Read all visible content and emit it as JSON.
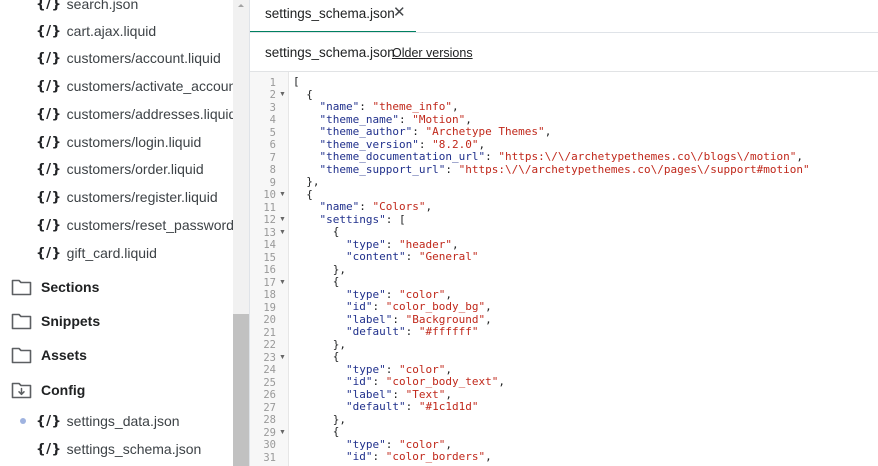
{
  "sidebar": {
    "files_top": [
      {
        "icon": "{/}",
        "label": "search.json"
      },
      {
        "icon": "{/}",
        "label": "cart.ajax.liquid"
      },
      {
        "icon": "{/}",
        "label": "customers/account.liquid"
      },
      {
        "icon": "{/}",
        "label": "customers/activate_account.li"
      },
      {
        "icon": "{/}",
        "label": "customers/addresses.liquid"
      },
      {
        "icon": "{/}",
        "label": "customers/login.liquid"
      },
      {
        "icon": "{/}",
        "label": "customers/order.liquid"
      },
      {
        "icon": "{/}",
        "label": "customers/register.liquid"
      },
      {
        "icon": "{/}",
        "label": "customers/reset_password.lic"
      },
      {
        "icon": "{/}",
        "label": "gift_card.liquid"
      }
    ],
    "folders": [
      {
        "label": "Sections",
        "icon": "folder-icon"
      },
      {
        "label": "Snippets",
        "icon": "folder-icon"
      },
      {
        "label": "Assets",
        "icon": "folder-icon"
      },
      {
        "label": "Config",
        "icon": "folder-open-icon"
      }
    ],
    "config_files": [
      {
        "icon": "{/}",
        "label": "settings_data.json"
      },
      {
        "icon": "{/}",
        "label": "settings_schema.json"
      }
    ]
  },
  "tab": {
    "label": "settings_schema.json",
    "close": "✕"
  },
  "file_header": {
    "title": "settings_schema.json",
    "older_versions": "Older versions"
  },
  "colors": {
    "accent": "#008060",
    "key": "#20308c",
    "string": "#c0281b",
    "gutter_bg": "#f7f7f7"
  },
  "editor": {
    "lines": [
      {
        "n": "1",
        "fold": false,
        "text": "["
      },
      {
        "n": "2",
        "fold": true,
        "text": "  {"
      },
      {
        "n": "3",
        "fold": false,
        "text": "    \"name\": \"theme_info\","
      },
      {
        "n": "4",
        "fold": false,
        "text": "    \"theme_name\": \"Motion\","
      },
      {
        "n": "5",
        "fold": false,
        "text": "    \"theme_author\": \"Archetype Themes\","
      },
      {
        "n": "6",
        "fold": false,
        "text": "    \"theme_version\": \"8.2.0\","
      },
      {
        "n": "7",
        "fold": false,
        "text": "    \"theme_documentation_url\": \"https:\\/\\/archetypethemes.co\\/blogs\\/motion\","
      },
      {
        "n": "8",
        "fold": false,
        "text": "    \"theme_support_url\": \"https:\\/\\/archetypethemes.co\\/pages\\/support#motion\""
      },
      {
        "n": "9",
        "fold": false,
        "text": "  },"
      },
      {
        "n": "10",
        "fold": true,
        "text": "  {"
      },
      {
        "n": "11",
        "fold": false,
        "text": "    \"name\": \"Colors\","
      },
      {
        "n": "12",
        "fold": true,
        "text": "    \"settings\": ["
      },
      {
        "n": "13",
        "fold": true,
        "text": "      {"
      },
      {
        "n": "14",
        "fold": false,
        "text": "        \"type\": \"header\","
      },
      {
        "n": "15",
        "fold": false,
        "text": "        \"content\": \"General\""
      },
      {
        "n": "16",
        "fold": false,
        "text": "      },"
      },
      {
        "n": "17",
        "fold": true,
        "text": "      {"
      },
      {
        "n": "18",
        "fold": false,
        "text": "        \"type\": \"color\","
      },
      {
        "n": "19",
        "fold": false,
        "text": "        \"id\": \"color_body_bg\","
      },
      {
        "n": "20",
        "fold": false,
        "text": "        \"label\": \"Background\","
      },
      {
        "n": "21",
        "fold": false,
        "text": "        \"default\": \"#ffffff\""
      },
      {
        "n": "22",
        "fold": false,
        "text": "      },"
      },
      {
        "n": "23",
        "fold": true,
        "text": "      {"
      },
      {
        "n": "24",
        "fold": false,
        "text": "        \"type\": \"color\","
      },
      {
        "n": "25",
        "fold": false,
        "text": "        \"id\": \"color_body_text\","
      },
      {
        "n": "26",
        "fold": false,
        "text": "        \"label\": \"Text\","
      },
      {
        "n": "27",
        "fold": false,
        "text": "        \"default\": \"#1c1d1d\""
      },
      {
        "n": "28",
        "fold": false,
        "text": "      },"
      },
      {
        "n": "29",
        "fold": true,
        "text": "      {"
      },
      {
        "n": "30",
        "fold": false,
        "text": "        \"type\": \"color\","
      },
      {
        "n": "31",
        "fold": false,
        "text": "        \"id\": \"color_borders\","
      }
    ]
  }
}
